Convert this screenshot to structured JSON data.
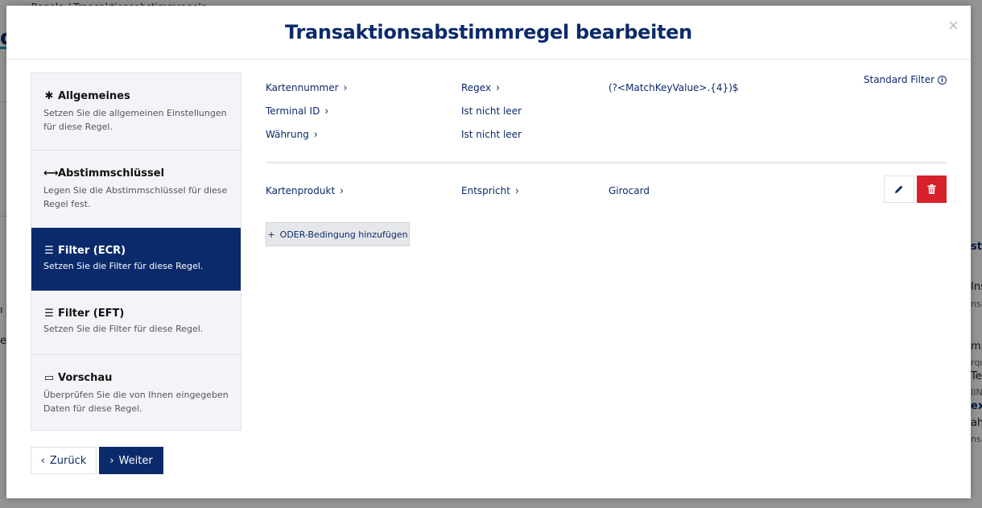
{
  "background": {
    "breadcrumb": "‹  Regeln   /   Transaktionsabstimmregeln",
    "title_fragment": "d",
    "fragments": [
      "ı Ü",
      "er",
      "stim",
      "Insa",
      "nsac",
      "mir",
      "rque",
      "Tern",
      "IINu",
      "ex",
      "ahru",
      "nsac"
    ]
  },
  "modal": {
    "title": "Transaktionsabstimmregel bearbeiten",
    "close_label": "×"
  },
  "steps": [
    {
      "icon": "✱",
      "icon_name": "asterisk-icon",
      "title": "Allgemeines",
      "desc": "Setzen Sie die allgemeinen Einstellungen für diese Regel."
    },
    {
      "icon": "⟷",
      "icon_name": "arrows-horizontal-icon",
      "title": "Abstimmschlüssel",
      "desc": "Legen Sie die Abstimmschlüssel für diese Regel fest."
    },
    {
      "icon": "☰",
      "icon_name": "filter-icon",
      "title": "Filter (ECR)",
      "desc": "Setzen Sie die Filter für diese Regel."
    },
    {
      "icon": "☰",
      "icon_name": "filter-icon",
      "title": "Filter (EFT)",
      "desc": "Setzen Sie die Filter für diese Regel."
    },
    {
      "icon": "▭",
      "icon_name": "laptop-icon",
      "title": "Vorschau",
      "desc": "Überprüfen Sie die von Ihnen eingegeben Daten für diese Regel."
    }
  ],
  "active_step": "Filter (ECR)",
  "buttons": {
    "back": "Zurück",
    "next": "Weiter",
    "add_or": "ODER-Bedingung hinzufügen",
    "add_or_icon": "+"
  },
  "standard_filter": {
    "label": "Standard Filter",
    "icon": "i"
  },
  "standard_conditions": [
    {
      "field": "Kartennummer",
      "operator": "Regex",
      "value": "(?<MatchKeyValue>.{4})$"
    },
    {
      "field": "Terminal ID",
      "operator": "Ist nicht leer",
      "value": ""
    },
    {
      "field": "Währung",
      "operator": "Ist nicht leer",
      "value": ""
    }
  ],
  "custom_conditions": [
    {
      "field": "Kartenprodukt",
      "operator": "Entspricht",
      "value": "Girocard"
    }
  ],
  "colors": {
    "primary": "#0b2a6b",
    "danger": "#d6202a",
    "sidebar_bg": "#f3f4f7",
    "overlay": "rgba(0,0,0,0.42)"
  }
}
